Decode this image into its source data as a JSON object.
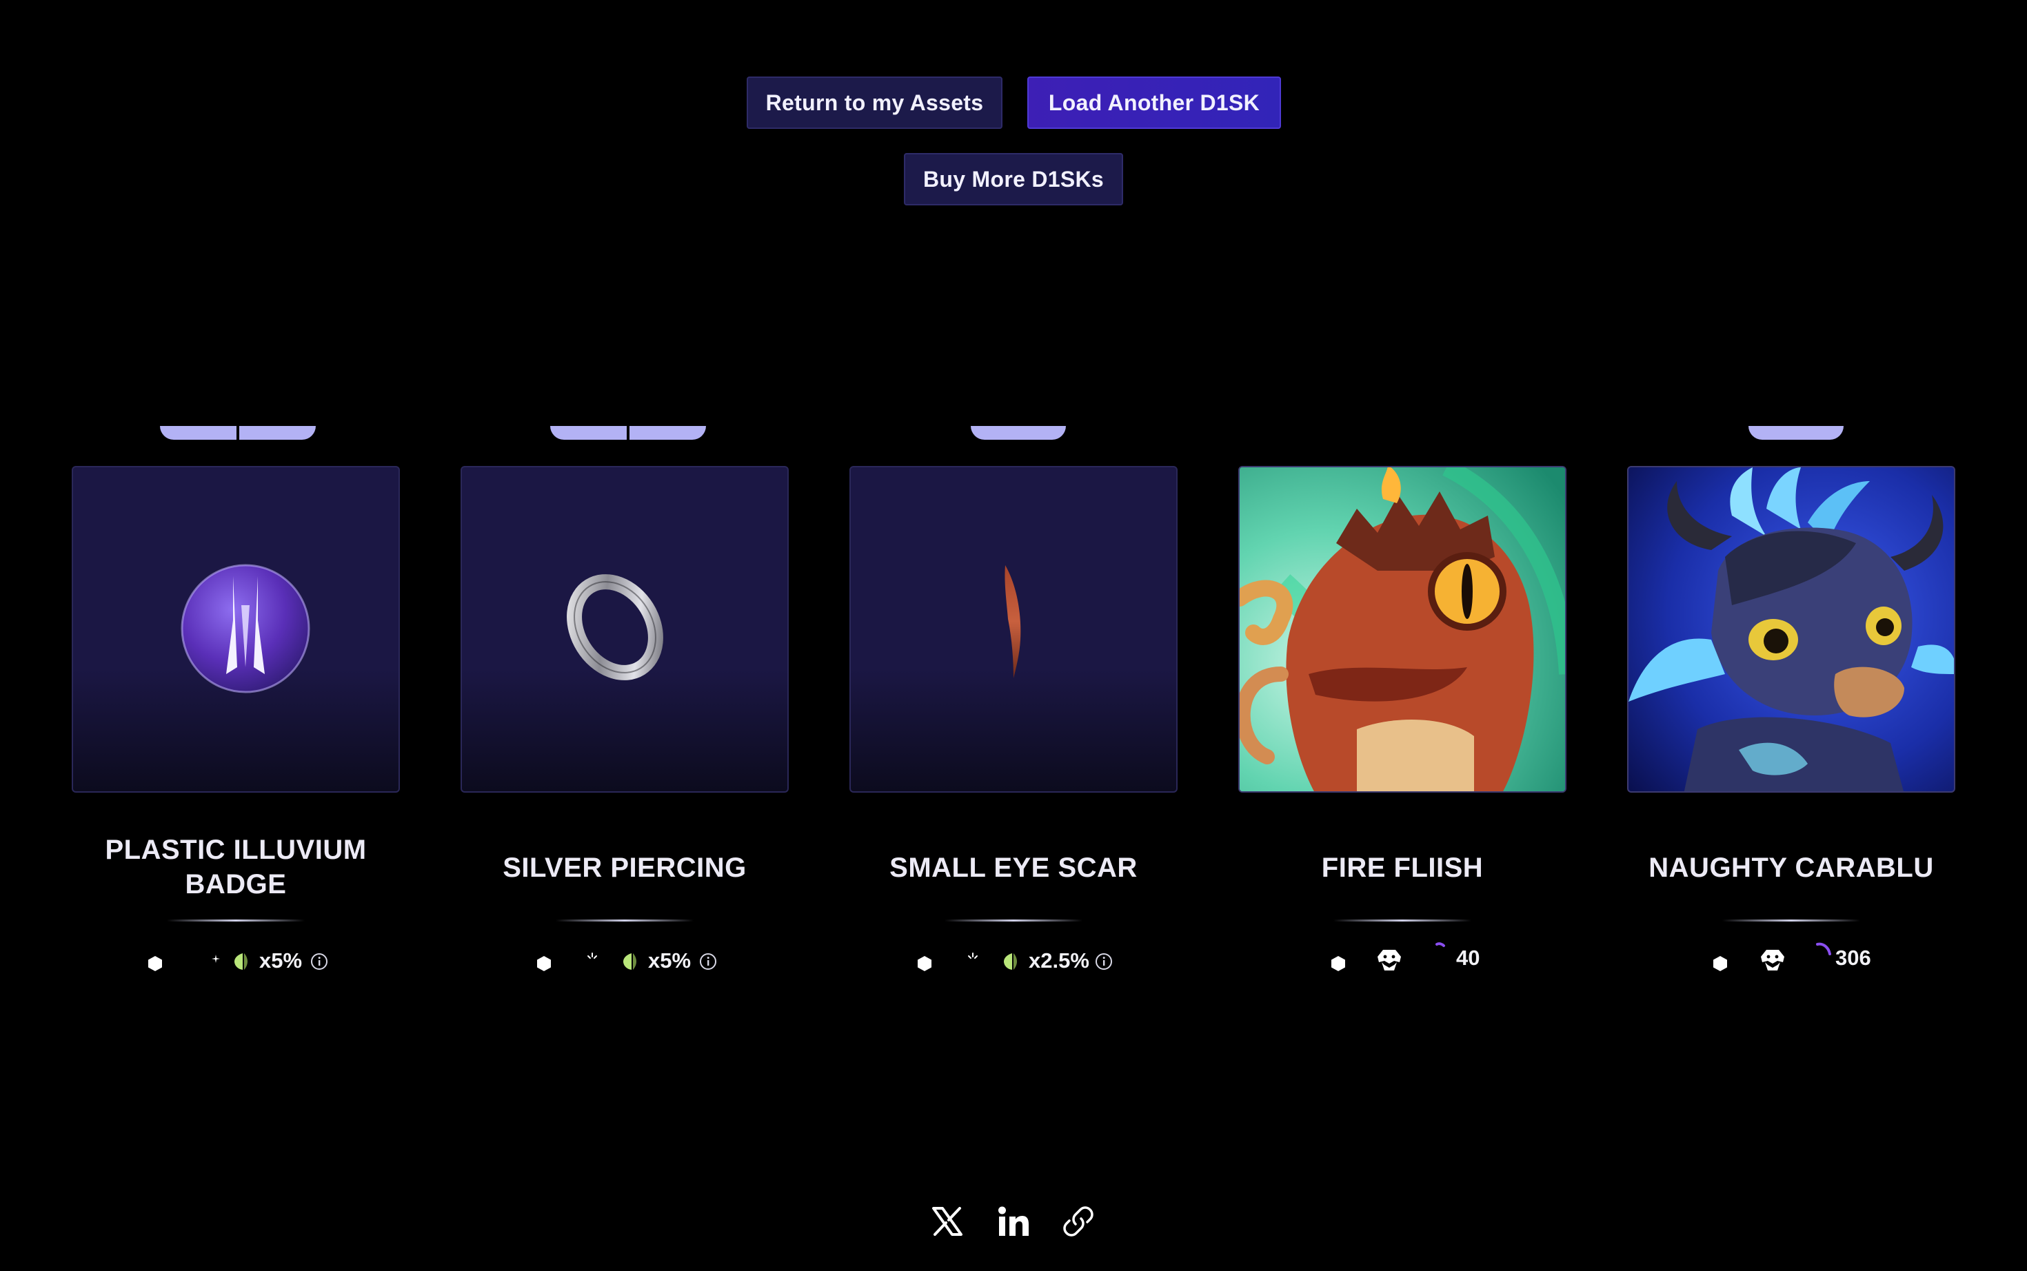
{
  "actions": {
    "return_label": "Return to my Assets",
    "load_label": "Load Another D1SK",
    "buy_label": "Buy More D1SKs"
  },
  "colors": {
    "background": "#000000",
    "button_secondary": "#1c1a4a",
    "button_primary": "#3d1fb5",
    "card_bg": "#1b1744",
    "rarity_tab": "#b3b2f5",
    "power_leaf": "#b9e67a",
    "arc_purple": "#8a4ef0"
  },
  "cards": [
    {
      "name_line1": "PLASTIC ILLUVIUM",
      "name_line2": "BADGE",
      "image": "illuvium-badge-icon",
      "multiplier": "x5%"
    },
    {
      "name": "SILVER PIERCING",
      "image": "silver-ring-icon",
      "multiplier": "x5%"
    },
    {
      "name": "SMALL EYE SCAR",
      "image": "scar-icon",
      "multiplier": "x2.5%"
    },
    {
      "name": "FIRE FLIISH",
      "image": "fire-fliish-illuvial-art",
      "power": "40"
    },
    {
      "name": "NAUGHTY CARABLU",
      "image": "carablu-illuvial-art",
      "power": "306"
    }
  ],
  "share": {
    "icons": [
      "x-twitter-icon",
      "linkedin-icon",
      "link-icon"
    ]
  }
}
